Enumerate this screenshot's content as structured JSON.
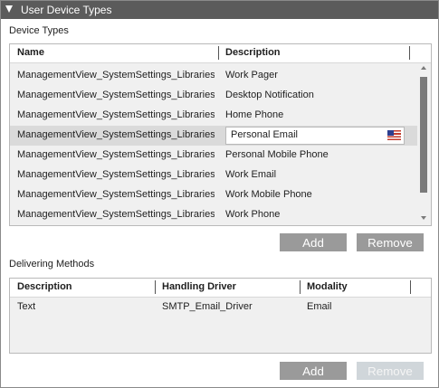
{
  "window": {
    "title": "User Device Types"
  },
  "device_types": {
    "section_label": "Device Types",
    "columns": [
      "Name",
      "Description"
    ],
    "rows": [
      {
        "name": "ManagementView_SystemSettings_Libraries_",
        "description": "Work Pager"
      },
      {
        "name": "ManagementView_SystemSettings_Libraries_",
        "description": "Desktop Notification"
      },
      {
        "name": "ManagementView_SystemSettings_Libraries_",
        "description": "Home Phone"
      },
      {
        "name": "ManagementView_SystemSettings_Libraries_",
        "description": "Personal Email",
        "selected": true,
        "editing": true
      },
      {
        "name": "ManagementView_SystemSettings_Libraries_",
        "description": "Personal Mobile Phone"
      },
      {
        "name": "ManagementView_SystemSettings_Libraries_",
        "description": "Work Email"
      },
      {
        "name": "ManagementView_SystemSettings_Libraries_",
        "description": "Work Mobile Phone"
      },
      {
        "name": "ManagementView_SystemSettings_Libraries_",
        "description": "Work Phone"
      }
    ],
    "add_label": "Add",
    "remove_label": "Remove"
  },
  "delivering_methods": {
    "section_label": "Delivering Methods",
    "columns": [
      "Description",
      "Handling Driver",
      "Modality"
    ],
    "rows": [
      {
        "description": "Text",
        "handling_driver": "SMTP_Email_Driver",
        "modality": "Email"
      }
    ],
    "add_label": "Add",
    "remove_label": "Remove",
    "remove_disabled": true
  },
  "icons": {
    "collapse": "collapse-triangle-icon",
    "flag": "us-flag-icon"
  },
  "colors": {
    "titlebar": "#5b5b5b",
    "button": "#9a9a9a",
    "button_disabled": "#d0d6da",
    "selected_row": "#dadada"
  }
}
